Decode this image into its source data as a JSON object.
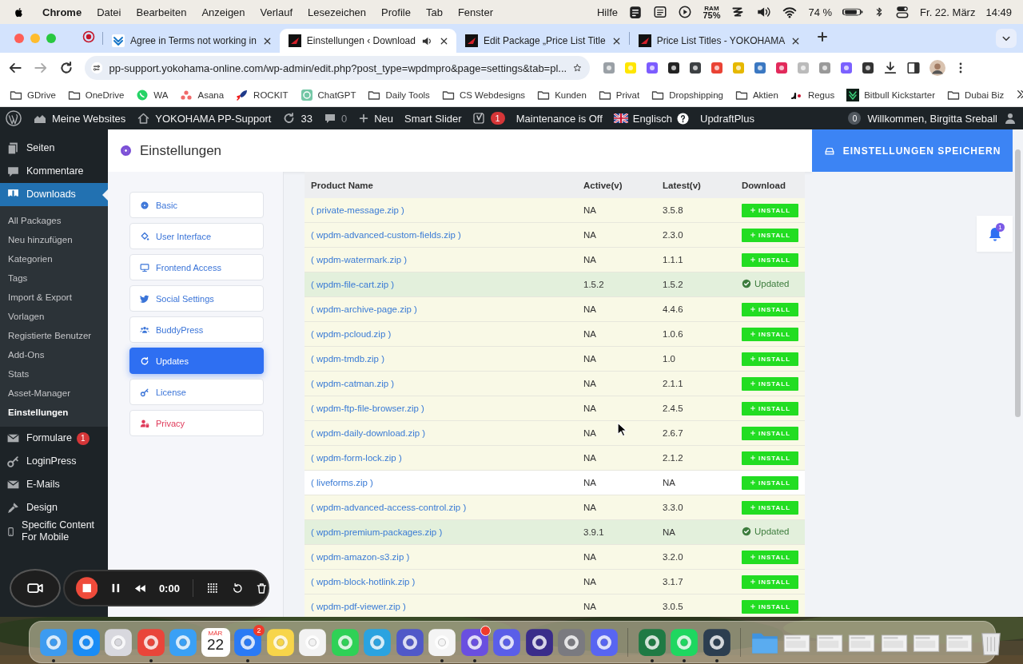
{
  "menubar": {
    "app": "Chrome",
    "menus": [
      "Datei",
      "Bearbeiten",
      "Anzeigen",
      "Verlauf",
      "Lesezeichen",
      "Profile",
      "Tab",
      "Fenster",
      "Hilfe"
    ],
    "ram_label": "RAM",
    "ram_value": "75%",
    "battery": "74 %",
    "date": "Fr. 22. März",
    "time": "14:49"
  },
  "browser": {
    "tabs": [
      {
        "title": "Agree in Terms not working in",
        "kind": "support",
        "selected": false,
        "audio": false
      },
      {
        "title": "Einstellungen ‹ Download",
        "kind": "site",
        "selected": true,
        "audio": true
      },
      {
        "title": "Edit Package „Price List Title",
        "kind": "site",
        "selected": false,
        "audio": false
      },
      {
        "title": "Price List Titles - YOKOHAMA",
        "kind": "site",
        "selected": false,
        "audio": false
      }
    ],
    "url": "pp-support.yokohama-online.com/wp-admin/edit.php?post_type=wpdmpro&page=settings&tab=pl...",
    "bookmarks": [
      {
        "label": "GDrive",
        "kind": "folder"
      },
      {
        "label": "OneDrive",
        "kind": "folder"
      },
      {
        "label": "WA",
        "kind": "chat"
      },
      {
        "label": "Asana",
        "kind": "dots"
      },
      {
        "label": "ROCKIT",
        "kind": "rocket"
      },
      {
        "label": "ChatGPT",
        "kind": "bot"
      },
      {
        "label": "Daily Tools",
        "kind": "folder"
      },
      {
        "label": "CS Webdesigns",
        "kind": "folder"
      },
      {
        "label": "Kunden",
        "kind": "folder"
      },
      {
        "label": "Privat",
        "kind": "folder"
      },
      {
        "label": "Dropshipping",
        "kind": "folder"
      },
      {
        "label": "Aktien",
        "kind": "folder"
      },
      {
        "label": "Regus",
        "kind": "mark"
      },
      {
        "label": "Bitbull Kickstarter",
        "kind": "badge"
      },
      {
        "label": "Dubai Biz",
        "kind": "folder"
      }
    ]
  },
  "adminbar": {
    "items": [
      {
        "kind": "sites",
        "label": "Meine Websites"
      },
      {
        "kind": "home",
        "label": "YOKOHAMA PP-Support"
      },
      {
        "kind": "updates",
        "label": "33"
      },
      {
        "kind": "comments",
        "label": "0"
      },
      {
        "kind": "new",
        "label": "Neu"
      },
      {
        "kind": "text",
        "label": "Smart Slider"
      },
      {
        "kind": "seo",
        "badge": "1"
      },
      {
        "kind": "text",
        "label": "Maintenance is Off"
      },
      {
        "kind": "language",
        "label": "Englisch"
      },
      {
        "kind": "text",
        "label": "UpdraftPlus"
      }
    ],
    "counter": "0",
    "greeting": "Willkommen, Birgitta Sreball"
  },
  "sidebar": {
    "items": [
      {
        "label": "Seiten",
        "kind": "pages",
        "selected": false
      },
      {
        "label": "Kommentare",
        "kind": "comments",
        "selected": false
      },
      {
        "label": "Downloads",
        "kind": "downloads",
        "selected": true,
        "children": [
          {
            "label": "All Packages",
            "selected": false
          },
          {
            "label": "Neu hinzufügen",
            "selected": false
          },
          {
            "label": "Kategorien",
            "selected": false
          },
          {
            "label": "Tags",
            "selected": false
          },
          {
            "label": "Import & Export",
            "selected": false
          },
          {
            "label": "Vorlagen",
            "selected": false
          },
          {
            "label": "Registierte Benutzer",
            "selected": false
          },
          {
            "label": "Add-Ons",
            "selected": false
          },
          {
            "label": "Stats",
            "selected": false
          },
          {
            "label": "Asset-Manager",
            "selected": false
          },
          {
            "label": "Einstellungen",
            "selected": true
          }
        ]
      },
      {
        "label": "Formulare",
        "kind": "forms",
        "badge": "1",
        "selected": false
      },
      {
        "label": "LoginPress",
        "kind": "login",
        "selected": false
      },
      {
        "label": "E-Mails",
        "kind": "emails",
        "selected": false
      },
      {
        "label": "Design",
        "kind": "design",
        "selected": false
      },
      {
        "label": "Specific Content For Mobile",
        "kind": "mobile",
        "selected": false
      }
    ]
  },
  "settings": {
    "title": "Einstellungen",
    "save_button": "EINSTELLUNGEN SPEICHERN",
    "nav": [
      {
        "label": "Basic",
        "kind": "basic",
        "selected": false
      },
      {
        "label": "User Interface",
        "kind": "interface",
        "selected": false
      },
      {
        "label": "Frontend Access",
        "kind": "frontend",
        "selected": false
      },
      {
        "label": "Social Settings",
        "kind": "social",
        "selected": false
      },
      {
        "label": "BuddyPress",
        "kind": "community",
        "selected": false
      },
      {
        "label": "Updates",
        "kind": "updates",
        "selected": true
      },
      {
        "label": "License",
        "kind": "license",
        "selected": false
      },
      {
        "label": "Privacy",
        "kind": "privacy",
        "selected": false
      }
    ],
    "table": {
      "columns": [
        "Product Name",
        "Active(v)",
        "Latest(v)",
        "Download"
      ],
      "rows": [
        {
          "name": "( private-message.zip )",
          "active": "NA",
          "latest": "3.5.8",
          "kind": "install",
          "action": "INSTALL",
          "color": "#f9f9e6"
        },
        {
          "name": "( wpdm-advanced-custom-fields.zip )",
          "active": "NA",
          "latest": "2.3.0",
          "kind": "install",
          "action": "INSTALL",
          "color": "#f9f9e6"
        },
        {
          "name": "( wpdm-watermark.zip )",
          "active": "NA",
          "latest": "1.1.1",
          "kind": "install",
          "action": "INSTALL",
          "color": "#f9f9e6"
        },
        {
          "name": "( wpdm-file-cart.zip )",
          "active": "1.5.2",
          "latest": "1.5.2",
          "kind": "updated",
          "action": "Updated",
          "color": "#e3f0dc"
        },
        {
          "name": "( wpdm-archive-page.zip )",
          "active": "NA",
          "latest": "4.4.6",
          "kind": "install",
          "action": "INSTALL",
          "color": "#f9f9e6"
        },
        {
          "name": "( wpdm-pcloud.zip )",
          "active": "NA",
          "latest": "1.0.6",
          "kind": "install",
          "action": "INSTALL",
          "color": "#f9f9e6"
        },
        {
          "name": "( wpdm-tmdb.zip )",
          "active": "NA",
          "latest": "1.0",
          "kind": "install",
          "action": "INSTALL",
          "color": "#f9f9e6"
        },
        {
          "name": "( wpdm-catman.zip )",
          "active": "NA",
          "latest": "2.1.1",
          "kind": "install",
          "action": "INSTALL",
          "color": "#f9f9e6"
        },
        {
          "name": "( wpdm-ftp-file-browser.zip )",
          "active": "NA",
          "latest": "2.4.5",
          "kind": "install",
          "action": "INSTALL",
          "color": "#f9f9e6"
        },
        {
          "name": "( wpdm-daily-download.zip )",
          "active": "NA",
          "latest": "2.6.7",
          "kind": "install",
          "action": "INSTALL",
          "color": "#f9f9e6"
        },
        {
          "name": "( wpdm-form-lock.zip )",
          "active": "NA",
          "latest": "2.1.2",
          "kind": "install",
          "action": "INSTALL",
          "color": "#f9f9e6"
        },
        {
          "name": "( liveforms.zip )",
          "active": "NA",
          "latest": "NA",
          "kind": "install",
          "action": "INSTALL",
          "color": "#ffffff"
        },
        {
          "name": "( wpdm-advanced-access-control.zip )",
          "active": "NA",
          "latest": "3.3.0",
          "kind": "install",
          "action": "INSTALL",
          "color": "#f9f9e6"
        },
        {
          "name": "( wpdm-premium-packages.zip )",
          "active": "3.9.1",
          "latest": "NA",
          "kind": "updated",
          "action": "Updated",
          "color": "#e3f0dc"
        },
        {
          "name": "( wpdm-amazon-s3.zip )",
          "active": "NA",
          "latest": "3.2.0",
          "kind": "install",
          "action": "INSTALL",
          "color": "#f9f9e6"
        },
        {
          "name": "( wpdm-block-hotlink.zip )",
          "active": "NA",
          "latest": "3.1.7",
          "kind": "install",
          "action": "INSTALL",
          "color": "#f9f9e6"
        },
        {
          "name": "( wpdm-pdf-viewer.zip )",
          "active": "NA",
          "latest": "3.0.5",
          "kind": "install",
          "action": "INSTALL",
          "color": "#f9f9e6"
        }
      ]
    },
    "notification": {
      "badge": "1"
    }
  },
  "recorder": {
    "time": "0:00"
  },
  "dock": {
    "items": [
      {
        "kind": "app",
        "color": "#3d9bf0",
        "running": true
      },
      {
        "kind": "app",
        "color": "#1a8cf5",
        "running": false
      },
      {
        "kind": "app",
        "color": "#d8d8de",
        "running": false
      },
      {
        "kind": "app",
        "color": "#e9453a",
        "running": true
      },
      {
        "kind": "app",
        "color": "#3aa0f5",
        "running": false
      },
      {
        "kind": "calendar",
        "month": "MÄR",
        "day": "22",
        "running": false
      },
      {
        "kind": "app",
        "color": "#2a7af5",
        "badge": "2",
        "running": true
      },
      {
        "kind": "app",
        "color": "#f7d54a",
        "running": false
      },
      {
        "kind": "app",
        "color": "#f2f2f2",
        "running": false
      },
      {
        "kind": "app",
        "color": "#2fd156",
        "running": false
      },
      {
        "kind": "app",
        "color": "#2aa3e0",
        "running": false
      },
      {
        "kind": "app",
        "color": "#5058c8",
        "running": false
      },
      {
        "kind": "app",
        "color": "#f4f4f4",
        "running": true
      },
      {
        "kind": "app",
        "color": "#6a4fe0",
        "dot": true,
        "running": true
      },
      {
        "kind": "app",
        "color": "#5a5ee8",
        "running": false
      },
      {
        "kind": "app",
        "color": "#3a2c8a",
        "running": false
      },
      {
        "kind": "app",
        "color": "#7a7a80",
        "running": false
      },
      {
        "kind": "app",
        "color": "#5865f2",
        "running": false
      },
      {
        "kind": "separator"
      },
      {
        "kind": "app",
        "color": "#1f7a44",
        "running": true
      },
      {
        "kind": "app",
        "color": "#1ed760",
        "running": true
      },
      {
        "kind": "app",
        "color": "#2c3e50",
        "running": true
      },
      {
        "kind": "separator"
      },
      {
        "kind": "folder",
        "color": "#5aacf0"
      },
      {
        "kind": "window"
      },
      {
        "kind": "window"
      },
      {
        "kind": "window"
      },
      {
        "kind": "window"
      },
      {
        "kind": "window"
      },
      {
        "kind": "window"
      },
      {
        "kind": "trash"
      }
    ]
  }
}
